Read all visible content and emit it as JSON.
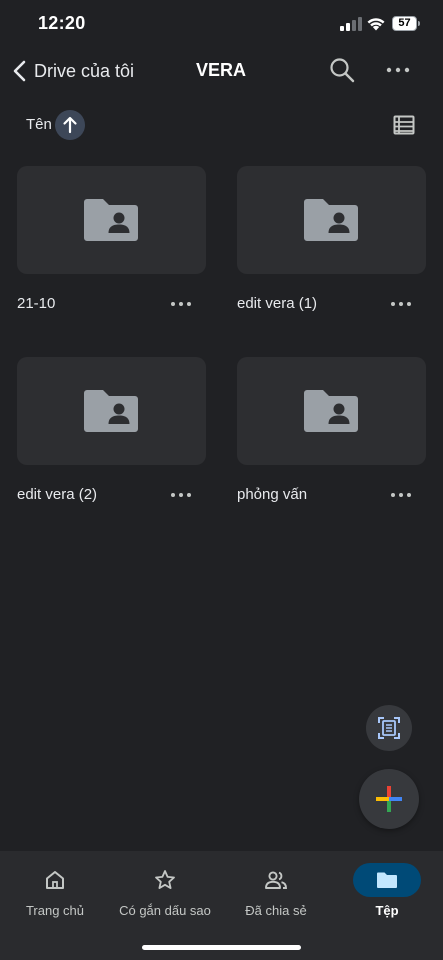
{
  "status_bar": {
    "time": "12:20",
    "battery": "57"
  },
  "top_bar": {
    "back_label": "Drive của tôi",
    "title": "VERA"
  },
  "sort": {
    "label": "Tên",
    "direction": "ascending"
  },
  "folders": [
    {
      "name": "21-10"
    },
    {
      "name": "edit vera (1)"
    },
    {
      "name": "edit vera (2)"
    },
    {
      "name": "phỏng vấn"
    }
  ],
  "bottom_nav": {
    "items": [
      {
        "label": "Trang chủ",
        "icon": "home-icon",
        "active": false
      },
      {
        "label": "Có gắn dấu sao",
        "icon": "star-icon",
        "active": false
      },
      {
        "label": "Đã chia sẻ",
        "icon": "people-icon",
        "active": false
      },
      {
        "label": "Tệp",
        "icon": "folder-icon",
        "active": true
      }
    ]
  },
  "colors": {
    "background": "#202124",
    "card": "#2d2e31",
    "active_nav_pill": "#004a77",
    "sort_chip": "#3d4758"
  }
}
